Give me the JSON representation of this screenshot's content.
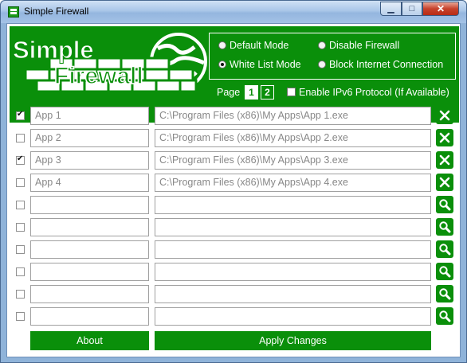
{
  "window": {
    "title": "Simple Firewall",
    "min_glyph": "▁",
    "max_glyph": "□",
    "close_glyph": "✕"
  },
  "logo": {
    "line1": "Simple",
    "line2": "Firewall"
  },
  "modes": [
    {
      "label": "Default Mode",
      "selected": false
    },
    {
      "label": "Disable Firewall",
      "selected": false
    },
    {
      "label": "White List Mode",
      "selected": true
    },
    {
      "label": "Block Internet Connection",
      "selected": false
    }
  ],
  "paging": {
    "label": "Page",
    "pages": [
      "1",
      "2"
    ],
    "current": "1"
  },
  "ipv6": {
    "label": "Enable IPv6 Protocol (If Available)",
    "checked": false
  },
  "rows": [
    {
      "checked": true,
      "name": "App 1",
      "path": "C:\\Program Files (x86)\\My Apps\\App 1.exe",
      "action": "remove-icon"
    },
    {
      "checked": false,
      "name": "App 2",
      "path": "C:\\Program Files (x86)\\My Apps\\App 2.exe",
      "action": "remove-icon"
    },
    {
      "checked": true,
      "name": "App 3",
      "path": "C:\\Program Files (x86)\\My Apps\\App 3.exe",
      "action": "remove-icon"
    },
    {
      "checked": false,
      "name": "App 4",
      "path": "C:\\Program Files (x86)\\My Apps\\App 4.exe",
      "action": "remove-icon"
    },
    {
      "checked": false,
      "name": "",
      "path": "",
      "action": "search-icon"
    },
    {
      "checked": false,
      "name": "",
      "path": "",
      "action": "search-icon"
    },
    {
      "checked": false,
      "name": "",
      "path": "",
      "action": "search-icon"
    },
    {
      "checked": false,
      "name": "",
      "path": "",
      "action": "search-icon"
    },
    {
      "checked": false,
      "name": "",
      "path": "",
      "action": "search-icon"
    },
    {
      "checked": false,
      "name": "",
      "path": "",
      "action": "search-icon"
    }
  ],
  "buttons": {
    "about": "About",
    "apply": "Apply Changes"
  },
  "colors": {
    "brand_green": "#0a8f0a",
    "white": "#ffffff"
  }
}
